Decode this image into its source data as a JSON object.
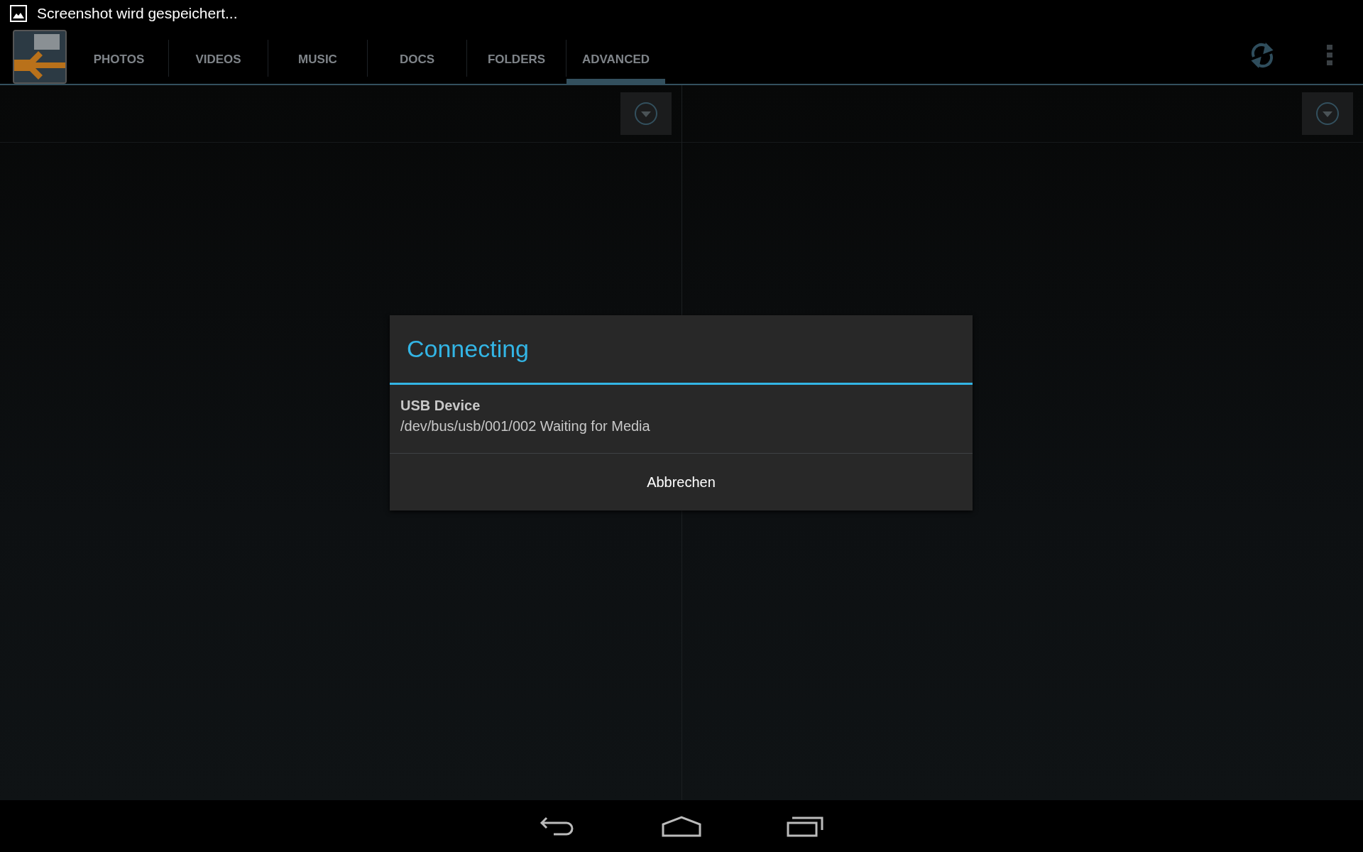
{
  "status_bar": {
    "notification": "Screenshot wird gespeichert..."
  },
  "tabs": [
    {
      "label": "PHOTOS",
      "selected": false
    },
    {
      "label": "VIDEOS",
      "selected": false
    },
    {
      "label": "MUSIC",
      "selected": false
    },
    {
      "label": "DOCS",
      "selected": false
    },
    {
      "label": "FOLDERS",
      "selected": false
    },
    {
      "label": "ADVANCED",
      "selected": true
    }
  ],
  "panes": [
    {
      "dropdown": true
    },
    {
      "dropdown": true
    }
  ],
  "dialog": {
    "title": "Connecting",
    "item_title": "USB Device",
    "item_text": "/dev/bus/usb/001/002 Waiting for Media",
    "button": "Abbrechen"
  }
}
